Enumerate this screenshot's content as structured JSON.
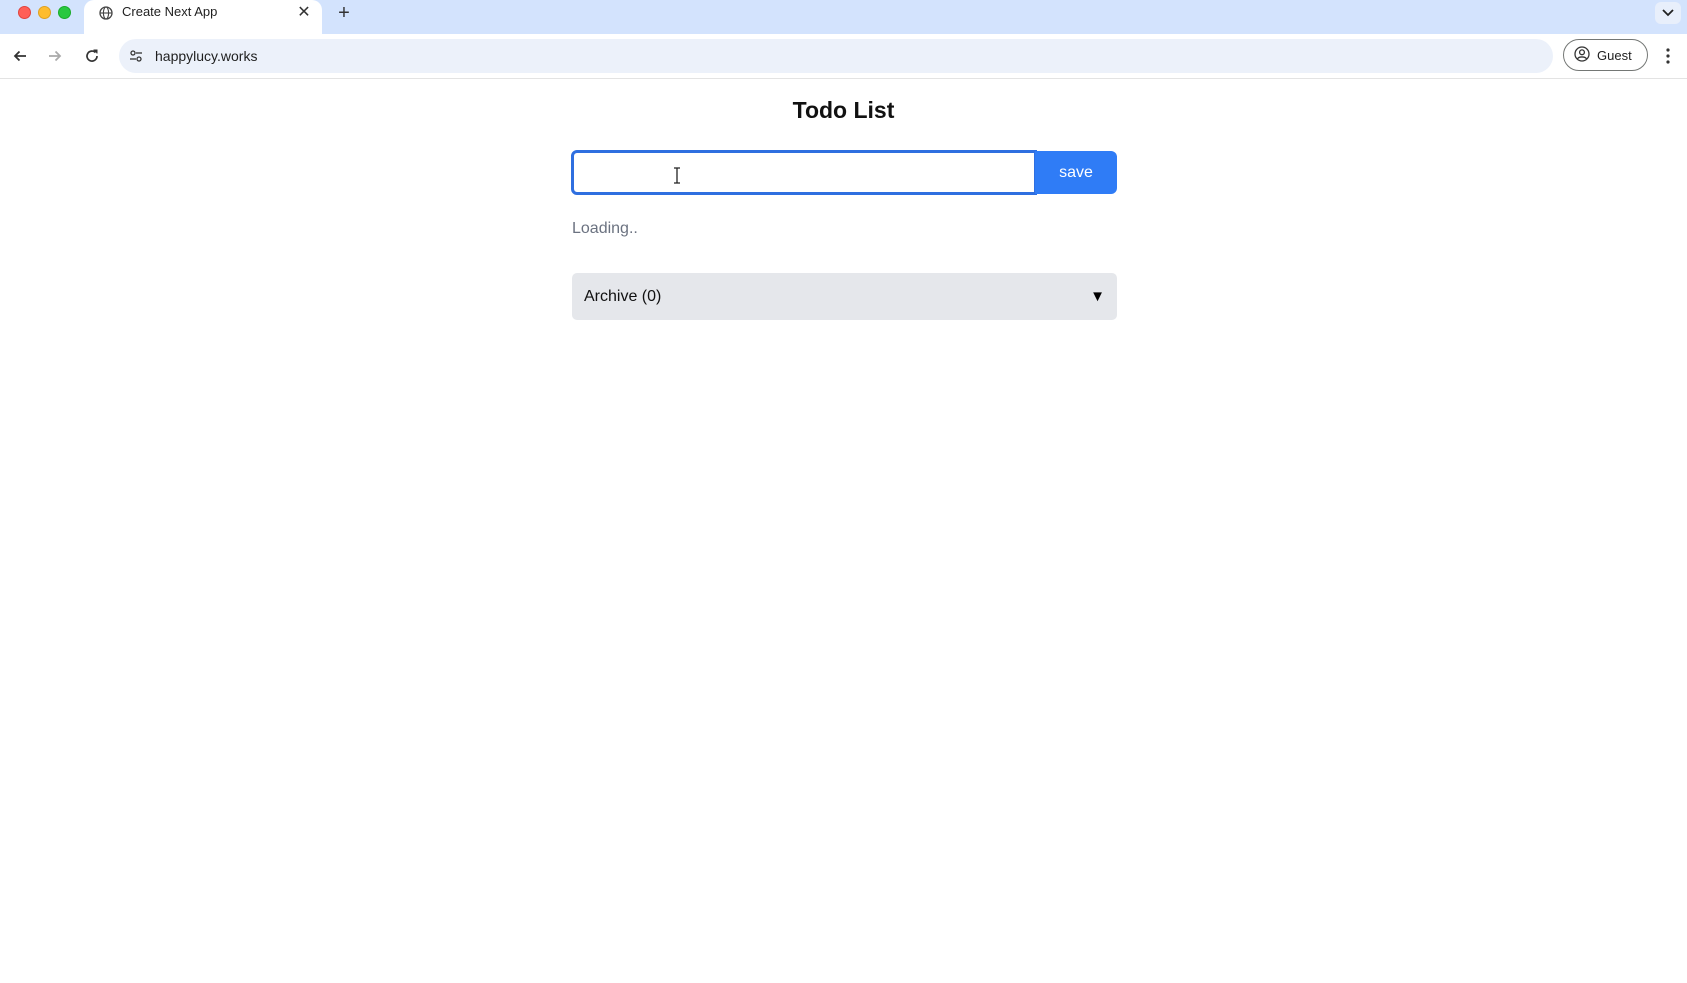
{
  "browser": {
    "tab_title": "Create Next App",
    "url": "happylucy.works",
    "profile_label": "Guest",
    "icons": {
      "favicon": "globe-icon",
      "close": "close-icon",
      "new_tab": "plus-icon",
      "tab_menu": "chevron-down-icon",
      "back": "arrow-left-icon",
      "forward": "arrow-right-icon",
      "reload": "reload-icon",
      "site_info": "tune-icon",
      "profile": "account-circle-icon",
      "menu": "kebab-icon"
    }
  },
  "app": {
    "title": "Todo List",
    "input": {
      "value": "",
      "placeholder": ""
    },
    "save_label": "save",
    "status_text": "Loading..",
    "archive_label": "Archive (0)",
    "archive_caret": "▼",
    "colors": {
      "accent": "#2f7cf6",
      "input_focus_border": "#2f6fe0",
      "archive_bg": "#e5e7eb",
      "muted_text": "#6b7280"
    }
  }
}
